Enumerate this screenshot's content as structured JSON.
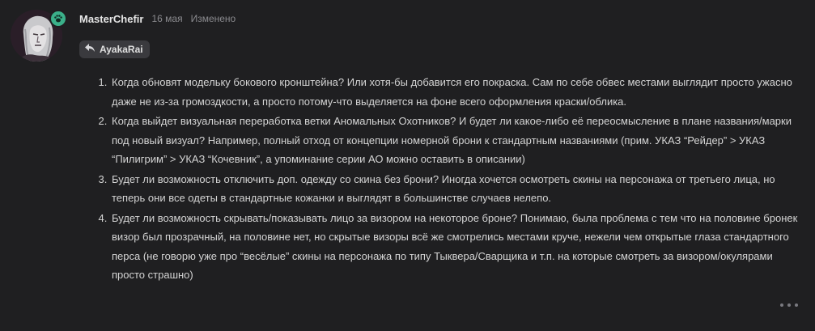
{
  "post": {
    "author": "MasterChefir",
    "date": "16 мая",
    "edited_label": "Изменено",
    "reply_to": "AyakaRai",
    "items": [
      "Когда обновят модельку бокового кронштейна? Или хотя-бы добавится его покраска. Сам по себе обвес местами выглядит просто ужасно даже не из-за громоздкости, а просто потому-что выделяется на фоне всего оформления краски/облика.",
      "Когда выйдет визуальная переработка ветки Аномальных Охотников? И будет ли какое-либо её переосмысление в плане названия/марки под новый визуал? Например, полный отход от концепции номерной брони к стандартным названиями (прим. УКАЗ “Рейдер” > УКАЗ “Пилигрим” > УКАЗ “Кочевник”, а упоминание серии АО можно оставить в описании)",
      "Будет ли возможность отключить доп. одежду со скина без брони? Иногда хочется осмотреть скины на персонажа от третьего лица, но теперь они все одеты в стандартные кожанки и выглядят в большинстве случаев нелепо.",
      "Будет ли возможность скрывать/показывать лицо за визором на некоторое броне? Понимаю, была проблема с тем что на половине бронек визор был прозрачный, на половине нет, но скрытые визоры всё же смотрелись местами круче, нежели чем открытые глаза стандартного перса (не говорю уже про “весёлые” скины на персонажа по типу Тыквера/Сварщика и т.п. на которые смотреть за визором/окулярами просто страшно)"
    ]
  },
  "icons": {
    "status": "paw-icon",
    "reply": "reply-arrow-icon",
    "more": "more-dots-icon"
  },
  "colors": {
    "background": "#1f1f21",
    "status_badge": "#3bb08a",
    "chip_background": "#3a3a3e",
    "muted_text": "#8a8a8e"
  }
}
